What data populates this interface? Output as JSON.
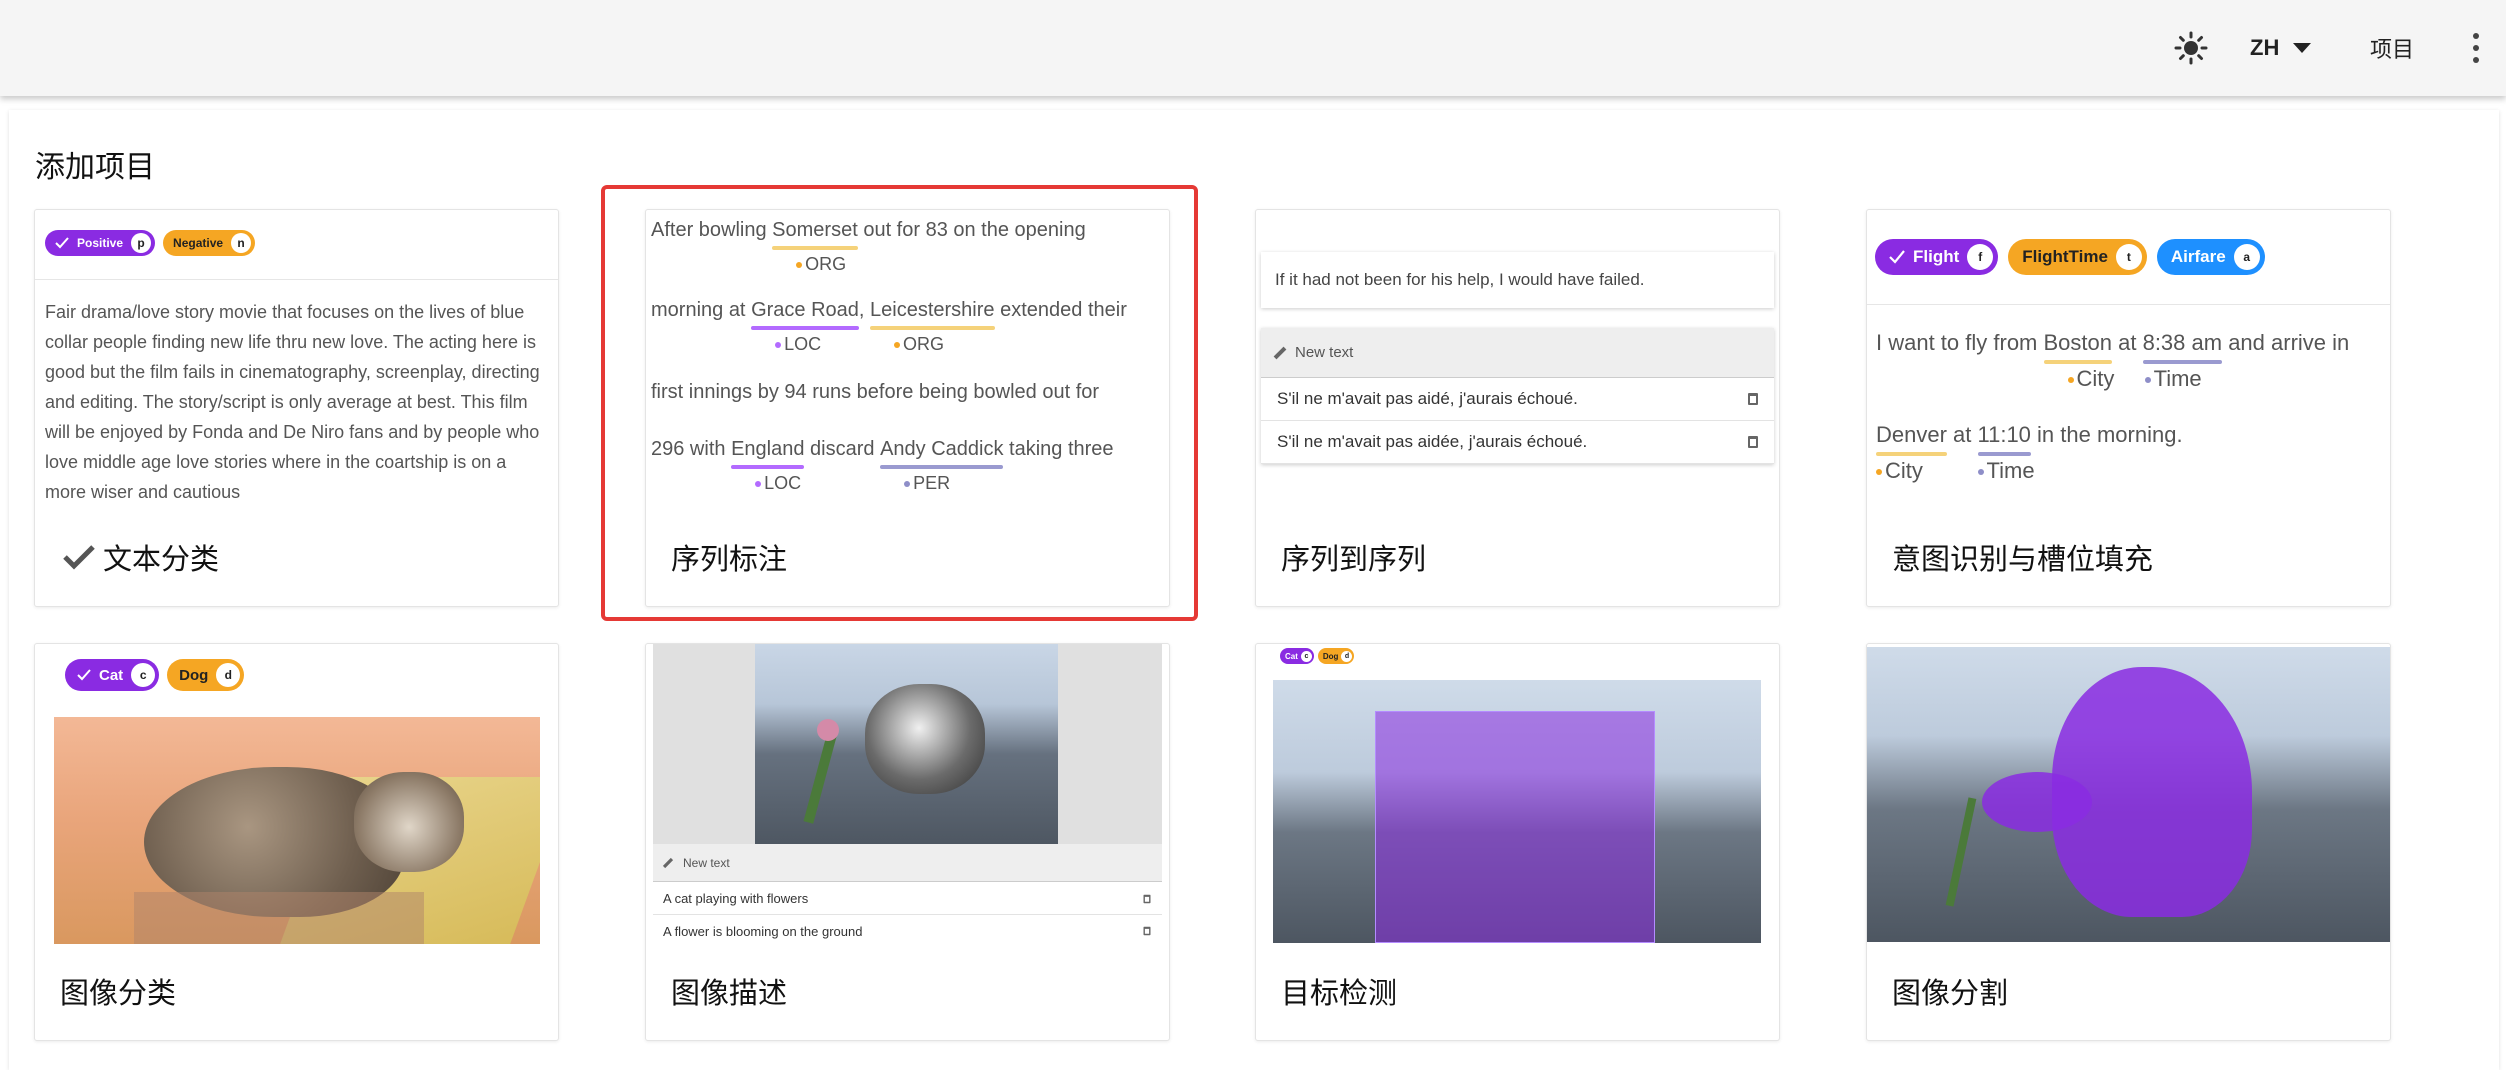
{
  "topbar": {
    "language": "ZH",
    "projects": "项目"
  },
  "page": {
    "title": "添加项目"
  },
  "cards": {
    "text_classification": {
      "title": "文本分类",
      "chips": [
        {
          "label": "Positive",
          "key": "p"
        },
        {
          "label": "Negative",
          "key": "n"
        }
      ],
      "body": "Fair drama/love story movie that focuses on the lives of blue collar people finding new life thru new love. The acting here is good but the film fails in cinematography, screenplay, directing and editing. The story/script is only average at best. This film will be enjoyed by Fonda and De Niro fans and by people who love middle age love stories where in the coartship is on a more wiser and cautious"
    },
    "sequence_labeling": {
      "title": "序列标注",
      "line1": {
        "pre": "After bowling ",
        "e1": "Somerset",
        "e1_label": "ORG",
        "post": " out for 83 on the opening"
      },
      "line2": {
        "pre": "morning at ",
        "e1": "Grace Road",
        "e1_label": "LOC",
        "mid": ", ",
        "e2": "Leicestershire",
        "e2_label": "ORG",
        "post": " extended their"
      },
      "line3": {
        "text": "first innings by 94 runs before being bowled out for"
      },
      "line4": {
        "pre": "296 with ",
        "e1": "England",
        "e1_label": "LOC",
        "mid": " discard ",
        "e2": "Andy Caddick",
        "e2_label": "PER",
        "post": " taking three"
      }
    },
    "seq2seq": {
      "title": "序列到序列",
      "source": "If it had not been for his help, I would have failed.",
      "new_text": "New text",
      "rows": [
        "S'il ne m'avait pas aidé, j'aurais échoué.",
        "S'il ne m'avait pas aidée, j'aurais échoué."
      ]
    },
    "intent_detection": {
      "title": "意图识别与槽位填充",
      "chips": [
        {
          "label": "Flight",
          "key": "f"
        },
        {
          "label": "FlightTime",
          "key": "t"
        },
        {
          "label": "Airfare",
          "key": "a"
        }
      ],
      "line1": {
        "pre": "I want to fly from ",
        "e1": "Boston",
        "e1_label": "City",
        "mid": " at ",
        "e2": "8:38 am",
        "e2_label": "Time",
        "post": " and arrive in"
      },
      "line2": {
        "e1": "Denver",
        "e1_label": "City",
        "mid": " at ",
        "e2": "11:10",
        "e2_label": "Time",
        "post": " in the morning."
      }
    },
    "image_classification": {
      "title": "图像分类",
      "chips": [
        {
          "label": "Cat",
          "key": "c"
        },
        {
          "label": "Dog",
          "key": "d"
        }
      ]
    },
    "image_captioning": {
      "title": "图像描述",
      "new_text": "New text",
      "rows": [
        "A cat playing with flowers",
        "A flower is blooming on the ground"
      ]
    },
    "object_detection": {
      "title": "目标检测",
      "chips": [
        {
          "label": "Cat",
          "key": "c"
        },
        {
          "label": "Dog",
          "key": "d"
        }
      ]
    },
    "segmentation": {
      "title": "图像分割"
    }
  },
  "colors": {
    "purple": "#8a2be2",
    "orange": "#f5a623",
    "blue": "#1e90ff",
    "highlight_border": "#e53935"
  }
}
